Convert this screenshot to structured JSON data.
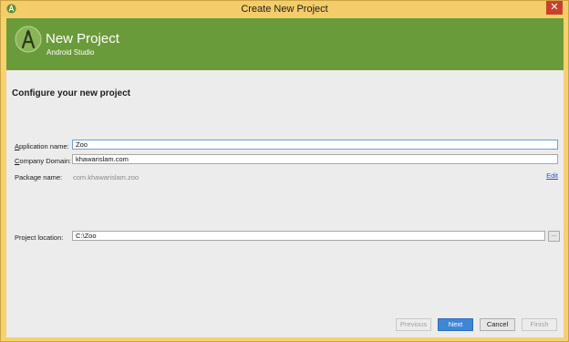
{
  "window": {
    "title": "Create New Project",
    "close_glyph": "✕"
  },
  "banner": {
    "title": "New Project",
    "subtitle": "Android Studio",
    "color": "#6a9b3a"
  },
  "section": {
    "title": "Configure your new project"
  },
  "form": {
    "app_name": {
      "label_prefix": "A",
      "label_rest": "pplication name:",
      "value": "Zoo"
    },
    "company_domain": {
      "label_prefix": "C",
      "label_rest": "ompany Domain:",
      "value": "khawarislam.com"
    },
    "package_name": {
      "label": "Package name:",
      "value": "com.khawarislam.zoo",
      "edit_link": "Edit"
    },
    "project_location": {
      "label": "Project location:",
      "value": "C:\\Zoo",
      "browse_label": "..."
    }
  },
  "buttons": {
    "previous": "Previous",
    "next": "Next",
    "cancel": "Cancel",
    "finish": "Finish"
  },
  "icons": {
    "app": "android-studio-icon",
    "logo": "android-studio-logo-icon",
    "close": "close-icon"
  }
}
